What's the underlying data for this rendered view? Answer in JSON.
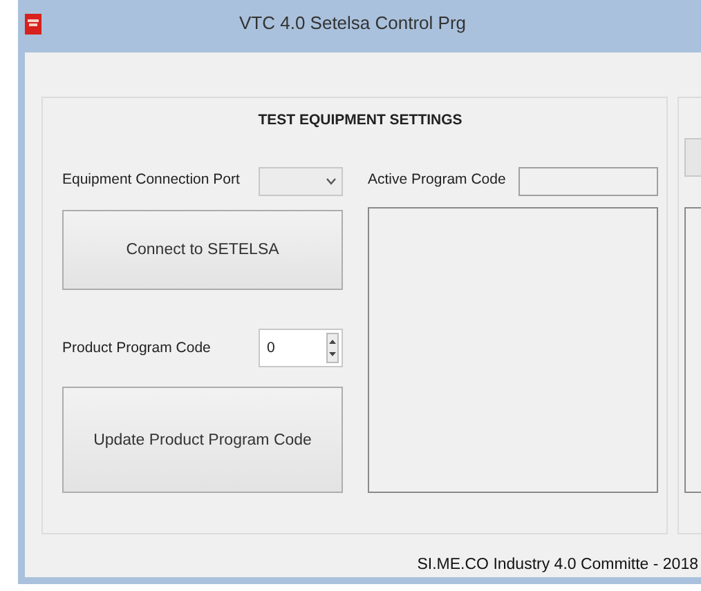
{
  "window": {
    "title": "VTC 4.0 Setelsa Control Prg"
  },
  "settings_group": {
    "title": "TEST EQUIPMENT SETTINGS",
    "port_label": "Equipment Connection Port",
    "active_program_label": "Active Program Code",
    "connect_button": "Connect to SETELSA",
    "product_code_label": "Product Program Code",
    "product_code_value": "0",
    "update_button": "Update Product Program Code"
  },
  "footer": "SI.ME.CO Industry 4.0 Committe - 2018"
}
